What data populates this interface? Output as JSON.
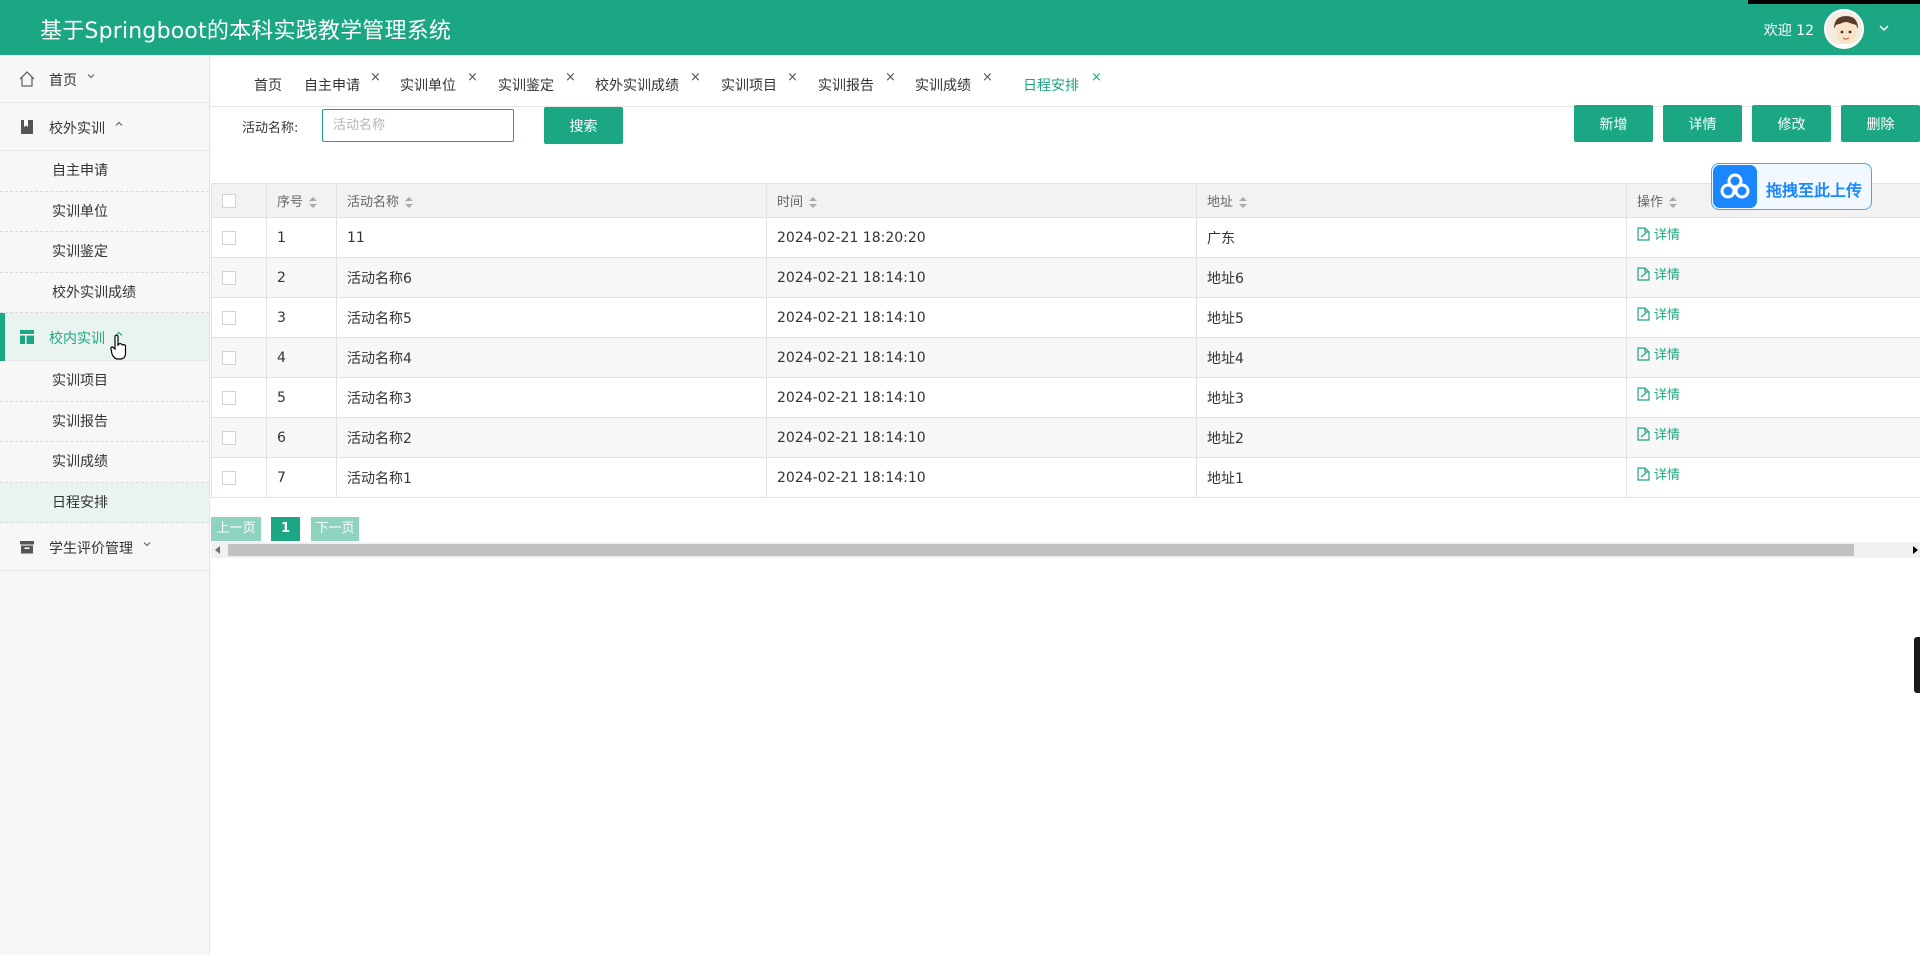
{
  "app": {
    "title": "基于Springboot的本科实践教学管理系统",
    "welcome": "欢迎 12",
    "brand_color": "#1ba784"
  },
  "sidebar": {
    "groups": [
      {
        "label": "首页",
        "icon": "home-icon",
        "caret": "down"
      },
      {
        "label": "校外实训",
        "icon": "book-icon",
        "caret": "up",
        "items": [
          "自主申请",
          "实训单位",
          "实训鉴定",
          "校外实训成绩"
        ]
      },
      {
        "label": "校内实训",
        "icon": "table-icon",
        "caret": "up",
        "active": true,
        "items": [
          "实训项目",
          "实训报告",
          "实训成绩",
          "日程安排"
        ]
      },
      {
        "label": "学生评价管理",
        "icon": "archive-icon",
        "caret": "down"
      }
    ],
    "active_item": "日程安排"
  },
  "tabs": [
    {
      "label": "首页",
      "closable": false
    },
    {
      "label": "自主申请",
      "closable": true
    },
    {
      "label": "实训单位",
      "closable": true
    },
    {
      "label": "实训鉴定",
      "closable": true
    },
    {
      "label": "校外实训成绩",
      "closable": true
    },
    {
      "label": "实训项目",
      "closable": true
    },
    {
      "label": "实训报告",
      "closable": true
    },
    {
      "label": "实训成绩",
      "closable": true
    },
    {
      "label": "日程安排",
      "closable": true,
      "active": true
    }
  ],
  "tab_close_glyph": "×",
  "search": {
    "label": "活动名称:",
    "placeholder": "活动名称",
    "value": "",
    "button": "搜索"
  },
  "toolbar": {
    "add": "新增",
    "detail": "详情",
    "edit": "修改",
    "delete": "删除"
  },
  "upload_badge": {
    "text": "拖拽至此上传"
  },
  "table": {
    "columns": [
      "序号",
      "活动名称",
      "时间",
      "地址",
      "操作"
    ],
    "rows": [
      {
        "no": "1",
        "name": "11",
        "time": "2024-02-21 18:20:20",
        "addr": "广东",
        "op": "详情"
      },
      {
        "no": "2",
        "name": "活动名称6",
        "time": "2024-02-21 18:14:10",
        "addr": "地址6",
        "op": "详情"
      },
      {
        "no": "3",
        "name": "活动名称5",
        "time": "2024-02-21 18:14:10",
        "addr": "地址5",
        "op": "详情"
      },
      {
        "no": "4",
        "name": "活动名称4",
        "time": "2024-02-21 18:14:10",
        "addr": "地址4",
        "op": "详情"
      },
      {
        "no": "5",
        "name": "活动名称3",
        "time": "2024-02-21 18:14:10",
        "addr": "地址3",
        "op": "详情"
      },
      {
        "no": "6",
        "name": "活动名称2",
        "time": "2024-02-21 18:14:10",
        "addr": "地址2",
        "op": "详情"
      },
      {
        "no": "7",
        "name": "活动名称1",
        "time": "2024-02-21 18:14:10",
        "addr": "地址1",
        "op": "详情"
      }
    ]
  },
  "pagination": {
    "prev": "上一页",
    "current": "1",
    "next": "下一页"
  }
}
